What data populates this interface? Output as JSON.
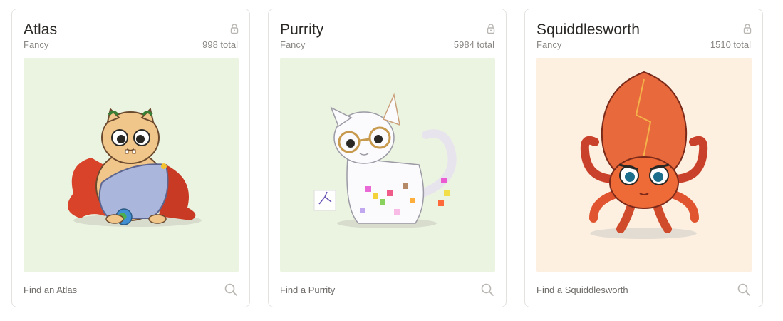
{
  "cards": [
    {
      "name": "Atlas",
      "type": "Fancy",
      "total": "998 total",
      "find_label": "Find an Atlas",
      "bg_color": "#ebf3e1",
      "icons": [
        "lock-icon",
        "search-icon"
      ]
    },
    {
      "name": "Purrity",
      "type": "Fancy",
      "total": "5984 total",
      "find_label": "Find a Purrity",
      "bg_color": "#ebf3e1",
      "icons": [
        "lock-icon",
        "search-icon"
      ]
    },
    {
      "name": "Squiddlesworth",
      "type": "Fancy",
      "total": "1510 total",
      "find_label": "Find a Squiddlesworth",
      "bg_color": "#fdf0e1",
      "icons": [
        "lock-icon",
        "search-icon"
      ]
    }
  ]
}
